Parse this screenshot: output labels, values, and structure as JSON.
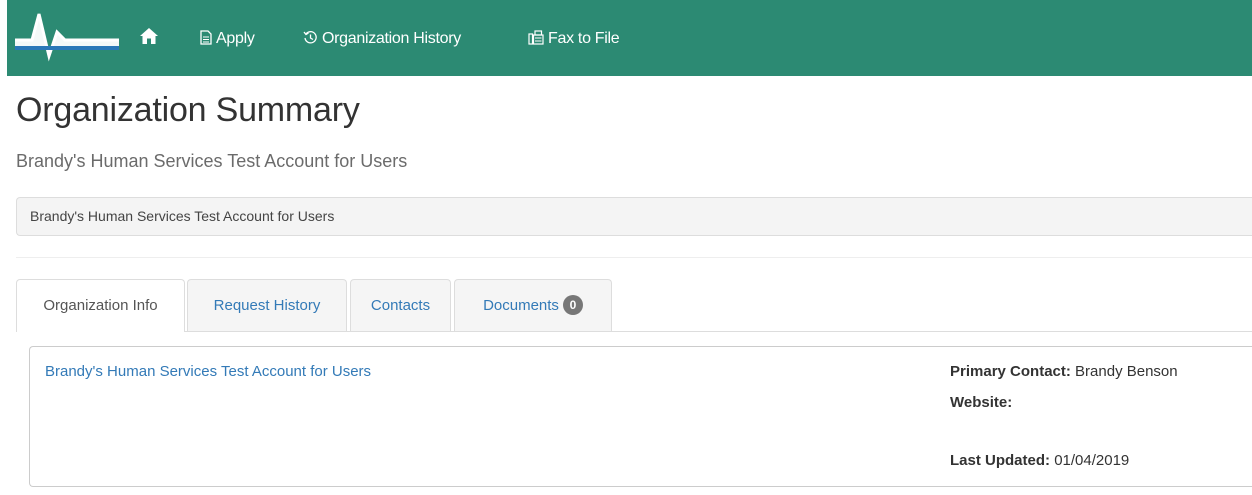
{
  "nav": {
    "home_icon": "home-icon",
    "items": [
      {
        "label": "Apply",
        "icon": "document-icon"
      },
      {
        "label": "Organization History",
        "icon": "history-icon"
      },
      {
        "label": "Fax to File",
        "icon": "fax-icon"
      }
    ],
    "brand_color": "#2c8a73"
  },
  "page": {
    "title": "Organization Summary",
    "subtitle": "Brandy's Human Services Test Account for Users",
    "breadcrumb": "Brandy's Human Services Test Account for Users"
  },
  "tabs": [
    {
      "label": "Organization Info",
      "active": true
    },
    {
      "label": "Request History",
      "active": false
    },
    {
      "label": "Contacts",
      "active": false
    },
    {
      "label": "Documents",
      "active": false,
      "badge": "0"
    }
  ],
  "panel": {
    "org_name": "Brandy's Human Services Test Account for Users",
    "primary_contact_label": "Primary Contact:",
    "primary_contact_value": "Brandy Benson",
    "website_label": "Website:",
    "website_value": "",
    "last_updated_label": "Last Updated:",
    "last_updated_value": "01/04/2019"
  }
}
